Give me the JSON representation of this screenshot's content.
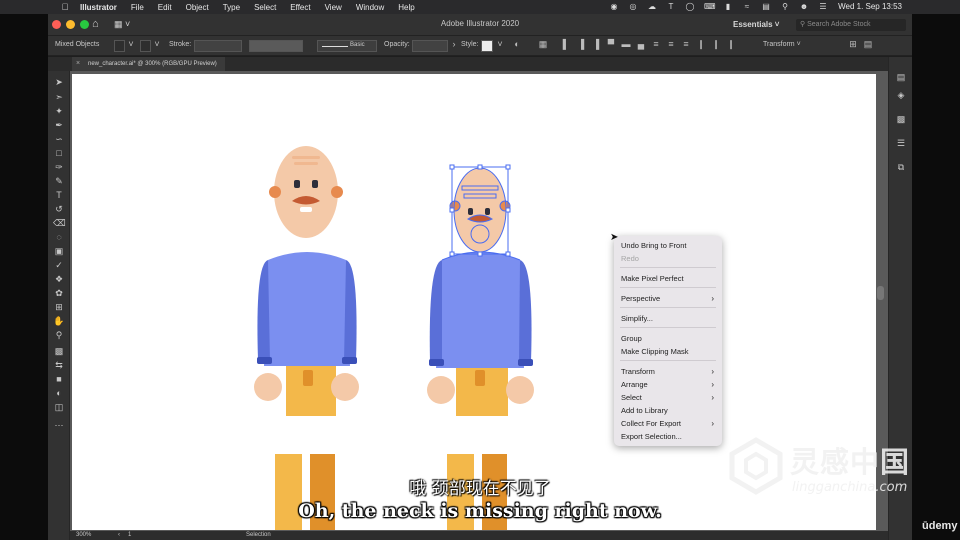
{
  "menubar": {
    "app": "Illustrator",
    "items": [
      "File",
      "Edit",
      "Object",
      "Type",
      "Select",
      "Effect",
      "View",
      "Window",
      "Help"
    ],
    "clock": "Wed 1. Sep  13:53",
    "status_icons": [
      "record-icon",
      "creative-cloud-icon",
      "cloud-icon",
      "text-icon",
      "circle-icon",
      "keyboard-icon",
      "battery-icon",
      "wifi-icon",
      "control-center-icon",
      "search-icon",
      "user-icon",
      "menu-icon"
    ]
  },
  "titlebar": {
    "title": "Adobe Illustrator 2020",
    "workspace": "Essentials",
    "search_placeholder": "Search Adobe Stock"
  },
  "controlbar": {
    "selection": "Mixed Objects",
    "stroke_label": "Stroke:",
    "brush": "Basic",
    "opacity_label": "Opacity:",
    "style_label": "Style:",
    "transform_label": "Transform"
  },
  "document": {
    "tab": "new_character.ai* @ 300% (RGB/GPU Preview)"
  },
  "statusbar": {
    "zoom": "300%",
    "artboard": "1",
    "tool": "Selection"
  },
  "context_menu": {
    "items": [
      {
        "label": "Undo Bring to Front",
        "enabled": true,
        "submenu": false
      },
      {
        "label": "Redo",
        "enabled": false,
        "submenu": false
      },
      {
        "label": "Make Pixel Perfect",
        "enabled": true,
        "submenu": false
      },
      {
        "label": "Perspective",
        "enabled": true,
        "submenu": true
      },
      {
        "label": "Simplify...",
        "enabled": true,
        "submenu": false
      },
      {
        "label": "Group",
        "enabled": true,
        "submenu": false
      },
      {
        "label": "Make Clipping Mask",
        "enabled": true,
        "submenu": false
      },
      {
        "label": "Transform",
        "enabled": true,
        "submenu": true
      },
      {
        "label": "Arrange",
        "enabled": true,
        "submenu": true
      },
      {
        "label": "Select",
        "enabled": true,
        "submenu": true
      },
      {
        "label": "Add to Library",
        "enabled": true,
        "submenu": false
      },
      {
        "label": "Collect For Export",
        "enabled": true,
        "submenu": true
      },
      {
        "label": "Export Selection...",
        "enabled": true,
        "submenu": false
      }
    ]
  },
  "subtitles": {
    "chinese": "哦 颈部现在不见了",
    "english": "Oh, the neck is missing right now."
  },
  "watermark": {
    "brand_cn": "灵感中国",
    "url": "lingganchina.com",
    "platform": "ūdemy"
  },
  "colors": {
    "skin": "#f4c9a8",
    "shirt": "#7b8ff0",
    "sleeve": "#5a6fd8",
    "cuff": "#3a4fb8",
    "pants": "#f3b84a",
    "pants_shadow": "#e0902a",
    "mustache": "#c45a32",
    "selection": "#4a6cf0"
  }
}
